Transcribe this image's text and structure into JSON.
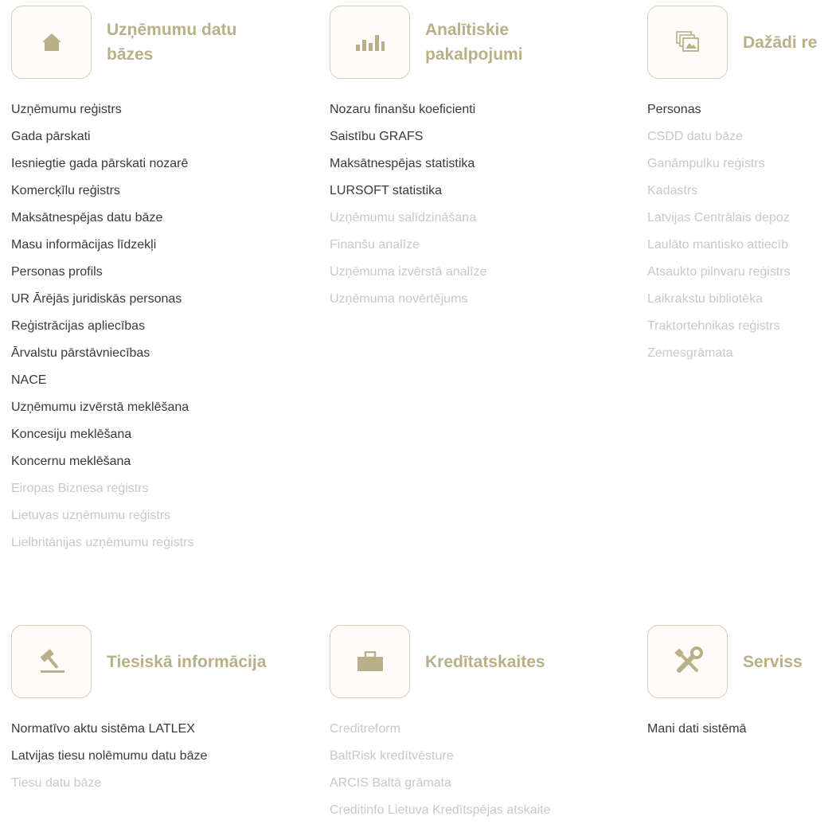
{
  "colors": {
    "accent": "#b9b089",
    "active_link": "#3a3a3a",
    "inactive_link": "#c8c8c8",
    "icon_border": "#d4d0b8"
  },
  "sections": {
    "companies": {
      "title": "Uzņēmumu datu bāzes",
      "title_lines": [
        "Uzņēmumu datu",
        "bāzes"
      ],
      "icon": "home-icon",
      "links": [
        {
          "label": "Uzņēmumu reģistrs",
          "active": true
        },
        {
          "label": "Gada pārskati",
          "active": true
        },
        {
          "label": "Iesniegtie gada pārskati nozarē",
          "active": true
        },
        {
          "label": "Komercķīlu reģistrs",
          "active": true
        },
        {
          "label": "Maksātnespējas datu bāze",
          "active": true
        },
        {
          "label": "Masu informācijas līdzekļi",
          "active": true
        },
        {
          "label": "Personas profils",
          "active": true
        },
        {
          "label": "UR Ārējās juridiskās personas",
          "active": true
        },
        {
          "label": "Reģistrācijas apliecības",
          "active": true
        },
        {
          "label": "Ārvalstu pārstāvniecības",
          "active": true
        },
        {
          "label": "NACE",
          "active": true
        },
        {
          "label": "Uzņēmumu izvērstā meklēšana",
          "active": true
        },
        {
          "label": "Koncesiju meklēšana",
          "active": true
        },
        {
          "label": "Koncernu meklēšana",
          "active": true
        },
        {
          "label": "Eiropas Biznesa reģistrs",
          "active": false
        },
        {
          "label": "Lietuvas uzņēmumu reģistrs",
          "active": false
        },
        {
          "label": "Lielbritānijas uzņēmumu reģistrs",
          "active": false
        }
      ]
    },
    "analytics": {
      "title": "Analītiskie pakalpojumi",
      "title_lines": [
        "Analītiskie",
        "pakalpojumi"
      ],
      "icon": "bar-chart-icon",
      "links": [
        {
          "label": "Nozaru finanšu koeficienti",
          "active": true
        },
        {
          "label": "Saistību GRAFS",
          "active": true
        },
        {
          "label": "Maksātnespējas statistika",
          "active": true
        },
        {
          "label": "LURSOFT statistika",
          "active": true
        },
        {
          "label": "Uzņēmumu salīdzināšana",
          "active": false
        },
        {
          "label": "Finanšu analīze",
          "active": false
        },
        {
          "label": "Uzņēmuma izvērstā analīze",
          "active": false
        },
        {
          "label": "Uzņēmuma novērtējums",
          "active": false
        }
      ]
    },
    "various": {
      "title": "Dažādi re",
      "icon": "images-icon",
      "links": [
        {
          "label": "Personas",
          "active": true
        },
        {
          "label": "CSDD datu bāze",
          "active": false
        },
        {
          "label": "Ganāmpulku reģistrs",
          "active": false
        },
        {
          "label": "Kadastrs",
          "active": false
        },
        {
          "label": "Latvijas Centrālais depoz",
          "active": false
        },
        {
          "label": "Laulāto mantisko attiecīb",
          "active": false
        },
        {
          "label": "Atsaukto pilnvaru reģistrs",
          "active": false
        },
        {
          "label": "Laikrakstu bibliotēka",
          "active": false
        },
        {
          "label": "Traktortehnikas reģistrs",
          "active": false
        },
        {
          "label": "Zemesgrāmata",
          "active": false
        }
      ]
    },
    "legal": {
      "title": "Tiesiskā informācija",
      "icon": "gavel-icon",
      "links": [
        {
          "label": "Normatīvo aktu sistēma LATLEX",
          "active": true
        },
        {
          "label": "Latvijas tiesu nolēmumu datu bāze",
          "active": true
        },
        {
          "label": "Tiesu datu bāze",
          "active": false
        }
      ]
    },
    "credit": {
      "title": "Kredītatskaites",
      "icon": "briefcase-icon",
      "links": [
        {
          "label": "Creditreform",
          "active": false
        },
        {
          "label": "BaltRisk kredītvēsture",
          "active": false
        },
        {
          "label": "ARCIS Baltā grāmata",
          "active": false
        },
        {
          "label": "Creditinfo Lietuva Kredītspējas atskaite",
          "active": false
        }
      ]
    },
    "service": {
      "title": "Serviss",
      "icon": "tools-icon",
      "links": [
        {
          "label": "Mani dati sistēmā",
          "active": true
        }
      ]
    }
  }
}
